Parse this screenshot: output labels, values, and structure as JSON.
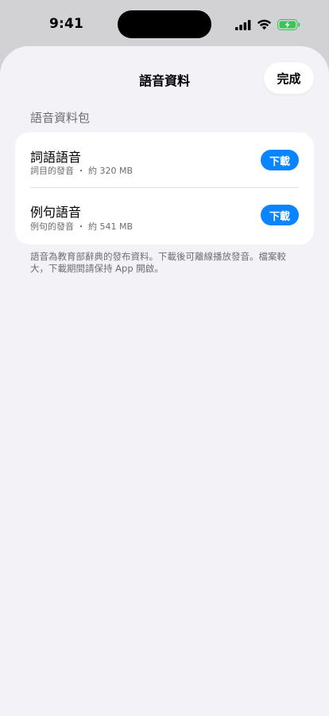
{
  "status_bar": {
    "time": "9:41"
  },
  "sheet": {
    "title": "語音資料",
    "done_label": "完成",
    "section_header": "語音資料包",
    "items": [
      {
        "title": "詞語語音",
        "subtitle": "詞目的發音 ・ 約 320 MB",
        "button_label": "下載"
      },
      {
        "title": "例句語音",
        "subtitle": "例句的發音 ・ 約 541 MB",
        "button_label": "下載"
      }
    ],
    "footer_note": "語音為教育部辭典的發布資料。下載後可離線播放發音。檔案較大，下載期間請保持 App 開啟。"
  },
  "colors": {
    "accent": "#0a84ff",
    "sheet_background": "#f2f2f7",
    "card_background": "#ffffff",
    "secondary_text": "#6d6d72",
    "battery_charging": "#34c759"
  },
  "icons": [
    "cellular-signal-icon",
    "wifi-icon",
    "battery-charging-icon"
  ]
}
